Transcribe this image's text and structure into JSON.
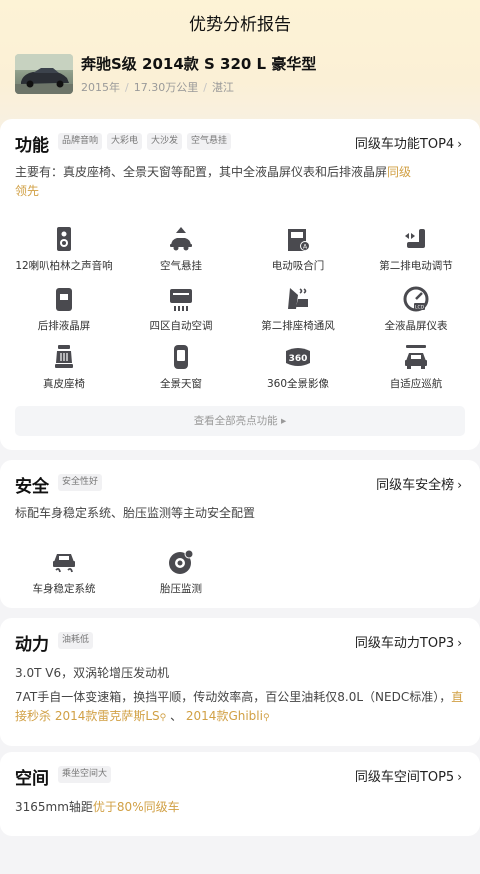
{
  "header": {
    "title": "优势分析报告"
  },
  "car": {
    "name": "奔驰S级 2014款 S 320 L 豪华型",
    "year": "2015年",
    "mileage": "17.30万公里",
    "city": "湛江",
    "separator": "/"
  },
  "function": {
    "title": "功能",
    "tags": [
      "品牌音响",
      "大彩电",
      "大沙发",
      "空气悬挂"
    ],
    "link": "同级车功能TOP4",
    "desc_prefix": "主要有：真皮座椅、全景天窗等配置，其中全液晶屏仪表和后排液晶屏",
    "desc_highlight_1": "同级",
    "desc_highlight_2": "领先",
    "features": [
      {
        "label": "12喇叭柏林之声音响",
        "icon": "speaker-icon"
      },
      {
        "label": "空气悬挂",
        "icon": "air-suspension-icon"
      },
      {
        "label": "电动吸合门",
        "icon": "soft-close-door-icon"
      },
      {
        "label": "第二排电动调节",
        "icon": "power-seat-icon"
      },
      {
        "label": "后排液晶屏",
        "icon": "rear-screen-icon"
      },
      {
        "label": "四区自动空调",
        "icon": "climate-control-icon"
      },
      {
        "label": "第二排座椅通风",
        "icon": "seat-ventilation-icon"
      },
      {
        "label": "全液晶屏仪表",
        "icon": "lcd-gauge-icon"
      },
      {
        "label": "真皮座椅",
        "icon": "leather-seat-icon"
      },
      {
        "label": "全景天窗",
        "icon": "panoramic-sunroof-icon"
      },
      {
        "label": "360全景影像",
        "icon": "camera-360-icon"
      },
      {
        "label": "自适应巡航",
        "icon": "adaptive-cruise-icon"
      }
    ],
    "more": "查看全部亮点功能 ▸"
  },
  "safety": {
    "title": "安全",
    "tags": [
      "安全性好"
    ],
    "link": "同级车安全榜",
    "desc": "标配车身稳定系统、胎压监测等主动安全配置",
    "features": [
      {
        "label": "车身稳定系统",
        "icon": "stability-control-icon"
      },
      {
        "label": "胎压监测",
        "icon": "tire-pressure-icon"
      }
    ]
  },
  "power": {
    "title": "动力",
    "tags": [
      "油耗低"
    ],
    "link": "同级车动力TOP3",
    "desc1": "3.0T V6，双涡轮增压发动机",
    "desc2_prefix": "7AT手自一体变速箱，换挡平顺，传动效率高，百公里油耗仅8.0L（NEDC标准），",
    "desc2_hl1": "直接秒杀 2014款雷克萨斯LS",
    "desc2_mid": " 、 ",
    "desc2_hl2": "2014款Ghibli"
  },
  "space": {
    "title": "空间",
    "tags": [
      "乘坐空间大"
    ],
    "link": "同级车空间TOP5",
    "desc_prefix": "3165mm轴距",
    "desc_highlight": "优于80%同级车"
  },
  "colors": {
    "accent": "#d1a045",
    "icon": "#4a4a4f"
  }
}
